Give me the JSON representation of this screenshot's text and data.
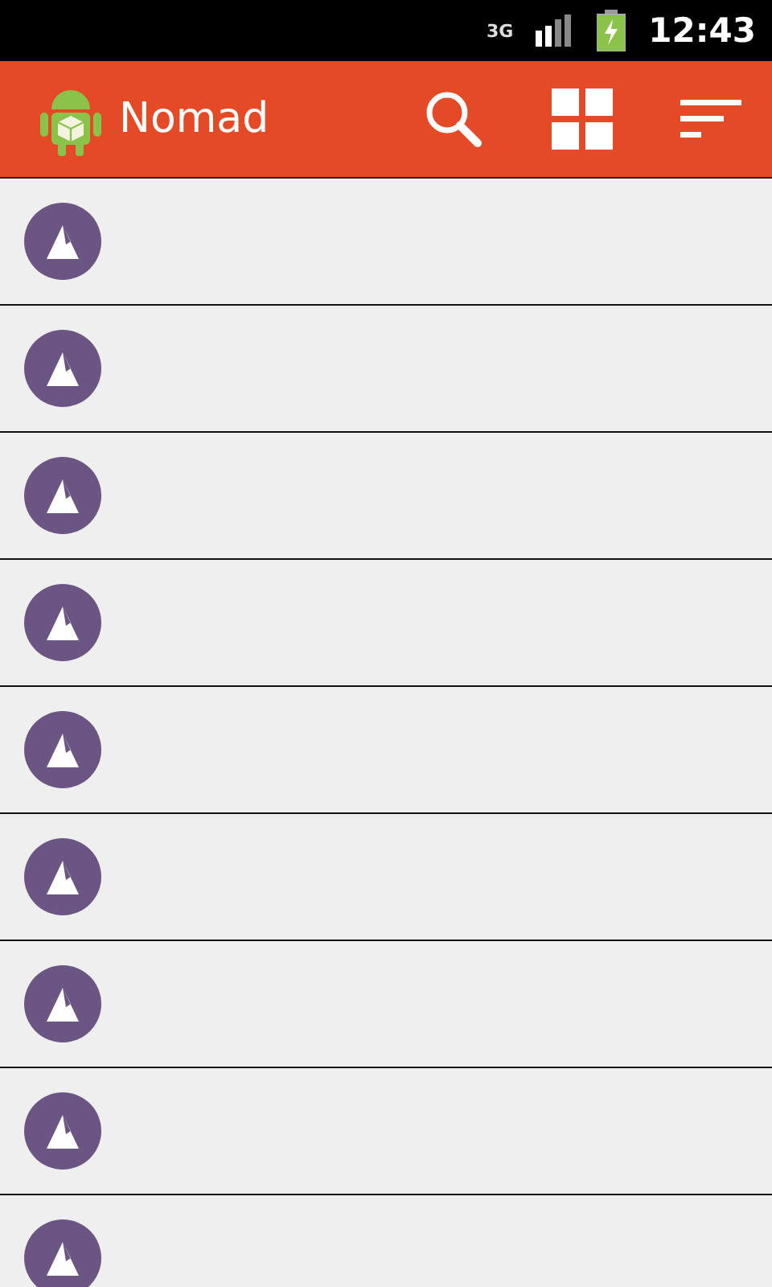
{
  "status_bar": {
    "network": "3G",
    "time": "12:43"
  },
  "action_bar": {
    "title": "Nomad"
  },
  "items": [
    {
      "kind": "place"
    },
    {
      "kind": "place"
    },
    {
      "kind": "place"
    },
    {
      "kind": "place"
    },
    {
      "kind": "place"
    },
    {
      "kind": "place"
    },
    {
      "kind": "place"
    },
    {
      "kind": "place"
    },
    {
      "kind": "place"
    }
  ]
}
